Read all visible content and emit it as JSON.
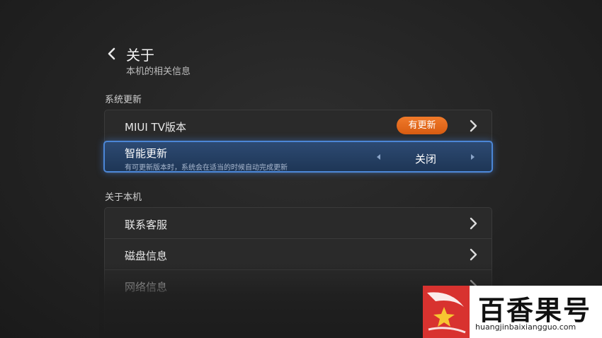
{
  "header": {
    "title": "关于",
    "subtitle": "本机的相关信息"
  },
  "sections": {
    "system_update": {
      "title": "系统更新",
      "miui_version_label": "MIUI TV版本",
      "update_badge": "有更新",
      "smart_update": {
        "label": "智能更新",
        "hint": "有可更新版本时，系统会在适当的时候自动完成更新",
        "value": "关闭"
      }
    },
    "about_device": {
      "title": "关于本机",
      "items": [
        {
          "label": "联系客服"
        },
        {
          "label": "磁盘信息"
        },
        {
          "label": "网络信息"
        }
      ]
    }
  },
  "watermark": {
    "brand": "百香果号",
    "url": "huangjinbaixiangguo.com"
  },
  "colors": {
    "badge": "#e46a1c",
    "focus_border": "#4b86d6",
    "focus_fill": "#24406a",
    "watermark_logo": "#d8322f"
  },
  "icons": {
    "back": "chevron-left-icon",
    "row_arrow": "chevron-right-icon",
    "value_prev": "triangle-left-icon",
    "value_next": "triangle-right-icon"
  }
}
